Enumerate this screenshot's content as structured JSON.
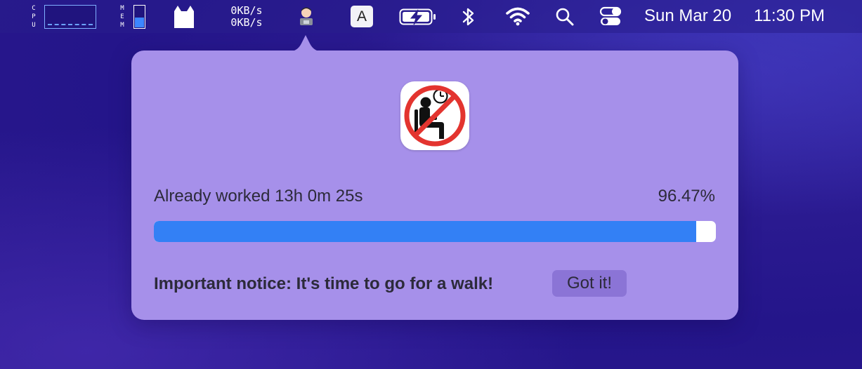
{
  "menubar": {
    "cpu_label": "CPU",
    "mem_label": "MEM",
    "mem_usage_fraction": 0.5,
    "net_upload": "0KB/s",
    "net_download": "0KB/s",
    "input_source": "A",
    "date": "Sun Mar 20",
    "time": "11:30 PM",
    "icons": [
      "cpu-graph-icon",
      "memory-bar-icon",
      "cat-icon",
      "worker-app-icon",
      "keyboard-input-icon",
      "battery-charging-icon",
      "bluetooth-icon",
      "wifi-icon",
      "search-icon",
      "control-center-icon"
    ]
  },
  "popover": {
    "worked_text": "Already worked 13h 0m 25s",
    "percent_text": "96.47%",
    "progress_fraction": 0.9647,
    "notice_text": "Important notice: It's time to go for a walk!",
    "got_it_label": "Got it!",
    "app_icon": "no-sitting-icon"
  },
  "colors": {
    "accent": "#3380f5",
    "popover_bg": "#a690ea",
    "button_bg": "#8b74d6",
    "forbidden_red": "#e3342f"
  }
}
